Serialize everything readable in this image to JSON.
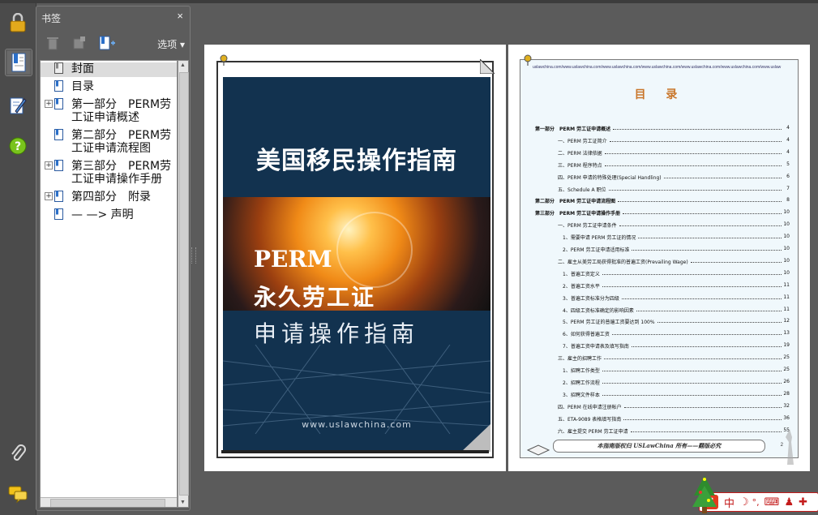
{
  "bookmark_panel": {
    "title": "书签",
    "close": "×",
    "options_label": "选项 ▾",
    "items": [
      {
        "label": "封面",
        "expandable": false
      },
      {
        "label": "目录",
        "expandable": false
      },
      {
        "label": "第一部分　PERM劳工证申请概述",
        "expandable": true
      },
      {
        "label": "第二部分　PERM劳工证申请流程图",
        "expandable": false
      },
      {
        "label": "第三部分　PERM劳工证申请操作手册",
        "expandable": true
      },
      {
        "label": "第四部分　附录",
        "expandable": true
      },
      {
        "label": "— —> 声明",
        "expandable": false
      }
    ]
  },
  "cover": {
    "title": "美国移民操作指南",
    "perm": "PERM",
    "line1": "永久劳工证",
    "line2": "申请操作指南",
    "url": "www.uslawchina.com"
  },
  "toc": {
    "header_url": "uslawchina.com/www.uslawchina.com/www.uslawchina.com/www.uslawchina.com/www.uslawchina.com/www.uslawchina.com/www.uslaw",
    "title": "目 录",
    "rows": [
      {
        "text": "第一部分　PERM 劳工证申请概述",
        "page": "4",
        "level": 0
      },
      {
        "text": "一、PERM 劳工证简介",
        "page": "4",
        "level": 1
      },
      {
        "text": "二、PERM 法律依据",
        "page": "4",
        "level": 1
      },
      {
        "text": "三、PERM 程序特点",
        "page": "5",
        "level": 1
      },
      {
        "text": "四、PERM 申请的特殊处理(Special Handling)",
        "page": "6",
        "level": 1
      },
      {
        "text": "五、Schedule A 职位",
        "page": "7",
        "level": 1
      },
      {
        "text": "第二部分　PERM 劳工证申请流程图",
        "page": "8",
        "level": 0
      },
      {
        "text": "第三部分　PERM 劳工证申请操作手册",
        "page": "10",
        "level": 0
      },
      {
        "text": "一、PERM 劳工证申请条件",
        "page": "10",
        "level": 1
      },
      {
        "text": "1、需要申请 PERM 劳工证的情况",
        "page": "10",
        "level": 2
      },
      {
        "text": "2、PERM 劳工证申请适用标准",
        "page": "10",
        "level": 2
      },
      {
        "text": "二、雇主从美劳工局获得批准的普遍工资(Prevailing Wage)",
        "page": "10",
        "level": 1
      },
      {
        "text": "1、普遍工资定义",
        "page": "10",
        "level": 2
      },
      {
        "text": "2、普遍工资水平",
        "page": "11",
        "level": 2
      },
      {
        "text": "3、普遍工资标准分为四级",
        "page": "11",
        "level": 2
      },
      {
        "text": "4、四级工资标准确定的影响因素",
        "page": "11",
        "level": 2
      },
      {
        "text": "5、PERM 劳工证的普遍工资要达到 100%",
        "page": "12",
        "level": 2
      },
      {
        "text": "6、如何获得普遍工资",
        "page": "13",
        "level": 2
      },
      {
        "text": "7、普遍工资申请表及填写指南",
        "page": "19",
        "level": 2
      },
      {
        "text": "三、雇主的招聘工作",
        "page": "25",
        "level": 1
      },
      {
        "text": "1、招聘工作类型",
        "page": "25",
        "level": 2
      },
      {
        "text": "2、招聘工作流程",
        "page": "26",
        "level": 2
      },
      {
        "text": "3、招聘文件样本",
        "page": "28",
        "level": 2
      },
      {
        "text": "四、PERM 在线申请注册帐户",
        "page": "32",
        "level": 1
      },
      {
        "text": "五、ETA-9089 表格填写指南",
        "page": "36",
        "level": 1
      },
      {
        "text": "六、雇主提交 PERM 劳工证申请",
        "page": "55",
        "level": 1
      }
    ],
    "footer": "本指南版权归 USLawChina 所有——翻版必究",
    "page_number": "2"
  },
  "ime": {
    "label": "中"
  },
  "colors": {
    "background": "#5b5b5b",
    "cover_navy": "#12324f",
    "toc_title": "#c9762a",
    "ime_red": "#c41c1c"
  }
}
